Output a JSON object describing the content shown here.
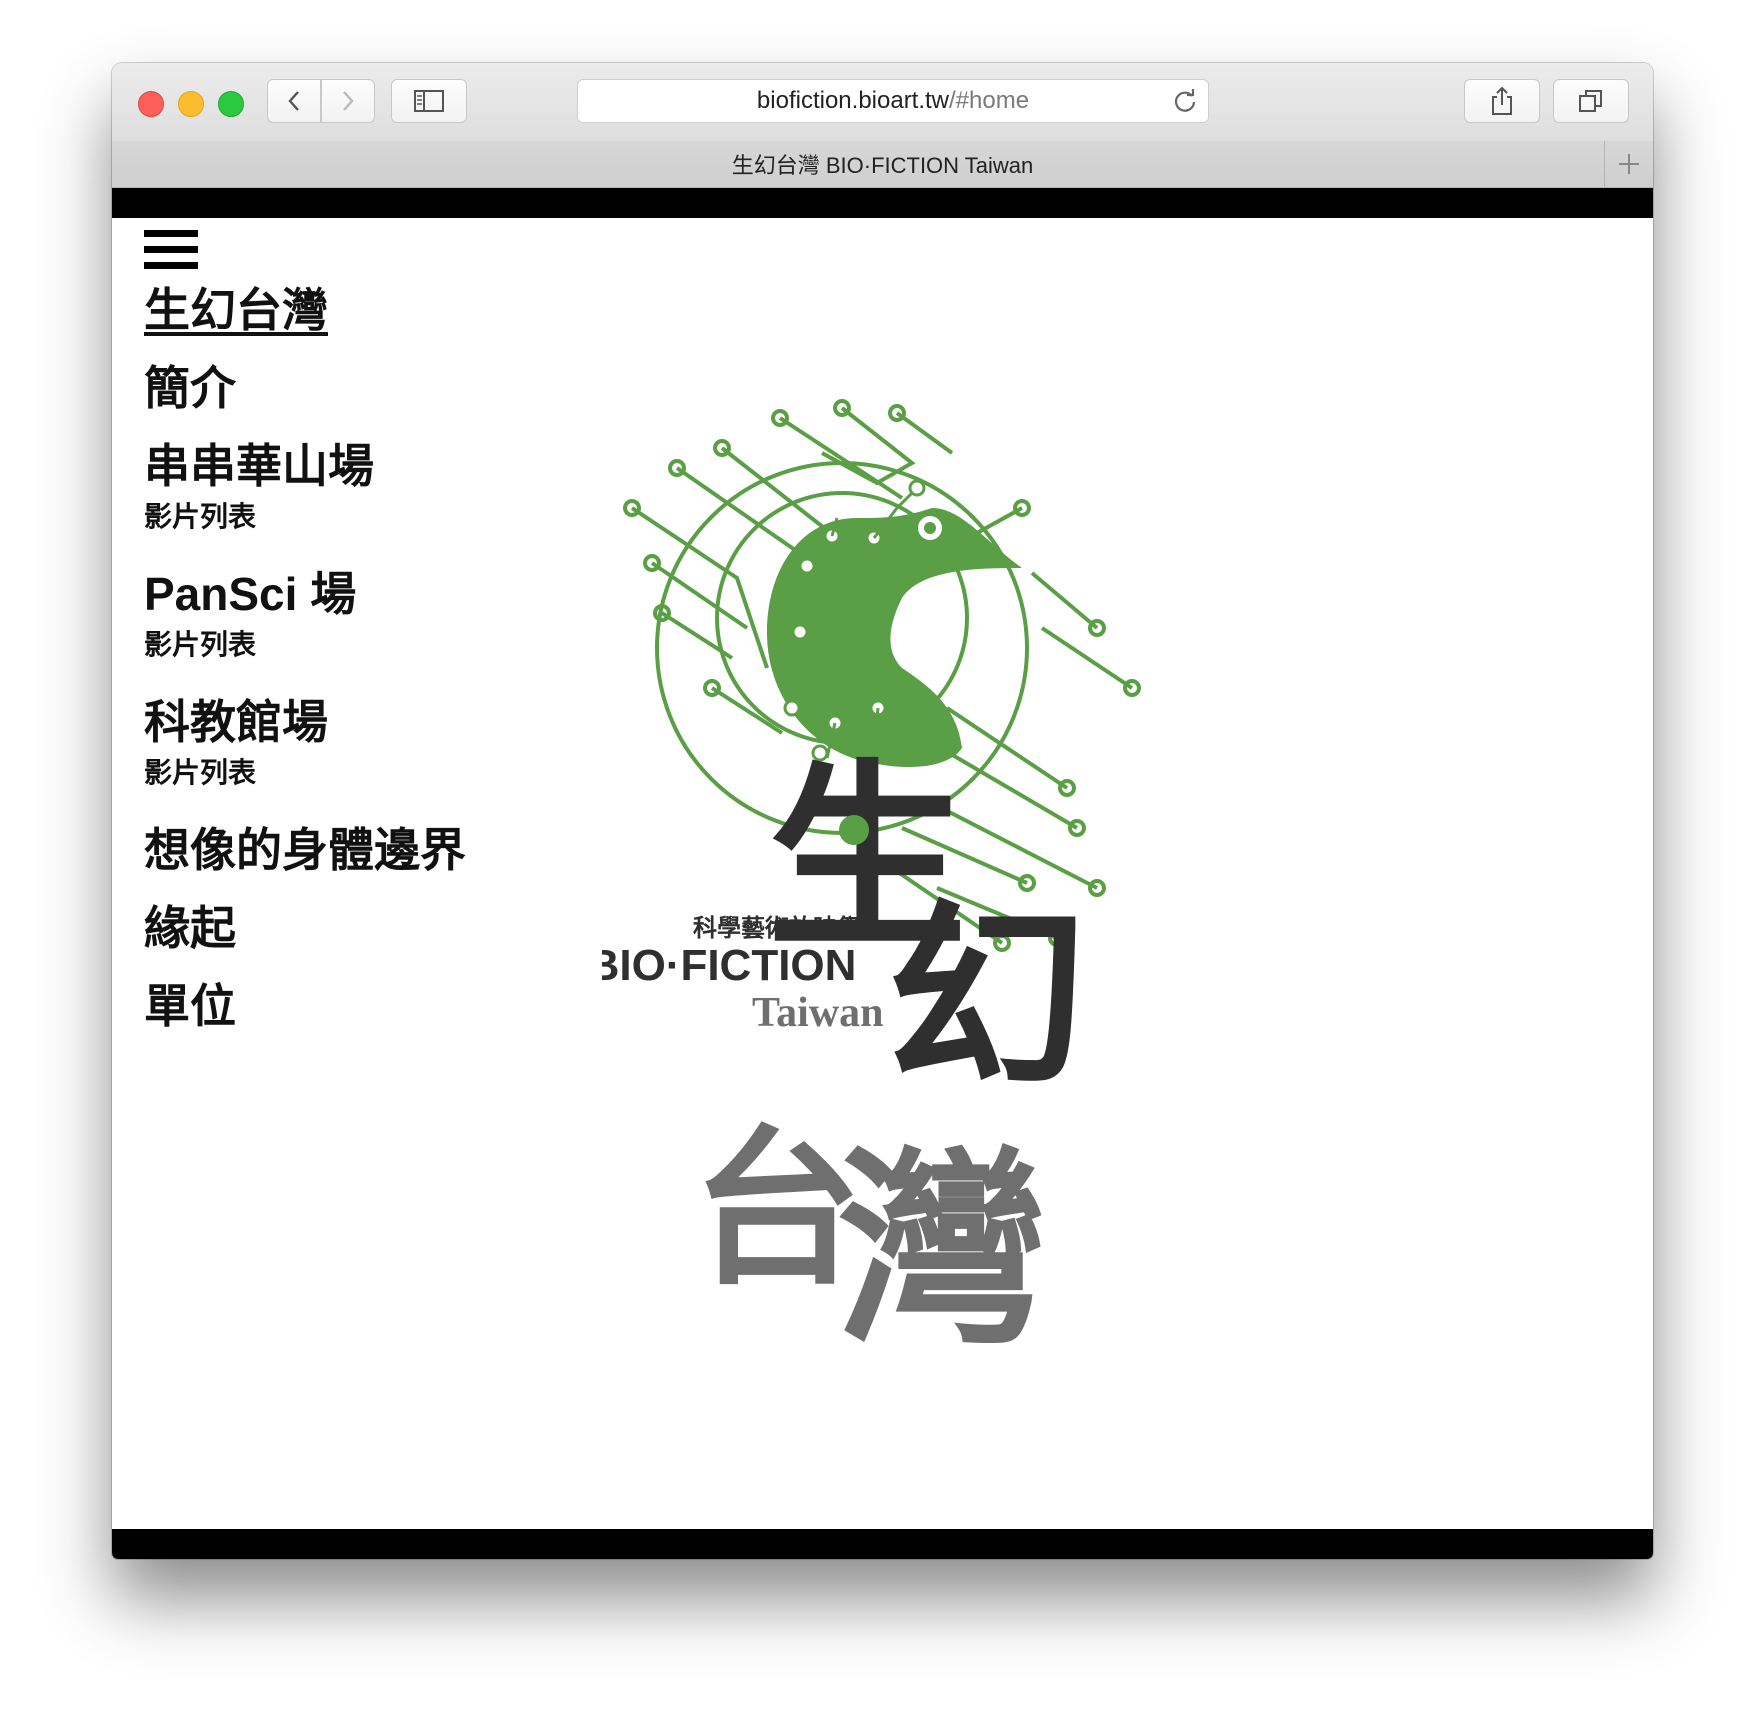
{
  "browser": {
    "url_host": "biofiction.bioart.tw",
    "url_path": "/#home",
    "tab_title": "生幻台灣 BIO·FICTION Taiwan"
  },
  "nav": {
    "items": [
      {
        "label": "生幻台灣",
        "active": true
      },
      {
        "label": "簡介"
      },
      {
        "label": "串串華山場",
        "sub": "影片列表"
      },
      {
        "label": "PanSci 場",
        "sub": "影片列表"
      },
      {
        "label": "科教館場",
        "sub": "影片列表"
      },
      {
        "label": "想像的身體邊界"
      },
      {
        "label": "緣起"
      },
      {
        "label": "單位"
      }
    ]
  },
  "logo": {
    "big_chars": [
      "生",
      "幻",
      "台",
      "灣"
    ],
    "subtitle_zh": "科學藝術放映祭",
    "brand": "BIO·FICTION",
    "brand_suffix": "Taiwan",
    "colors": {
      "green": "#5a9e45",
      "dark": "#2f2f2f",
      "gray": "#6f6f6f"
    }
  }
}
